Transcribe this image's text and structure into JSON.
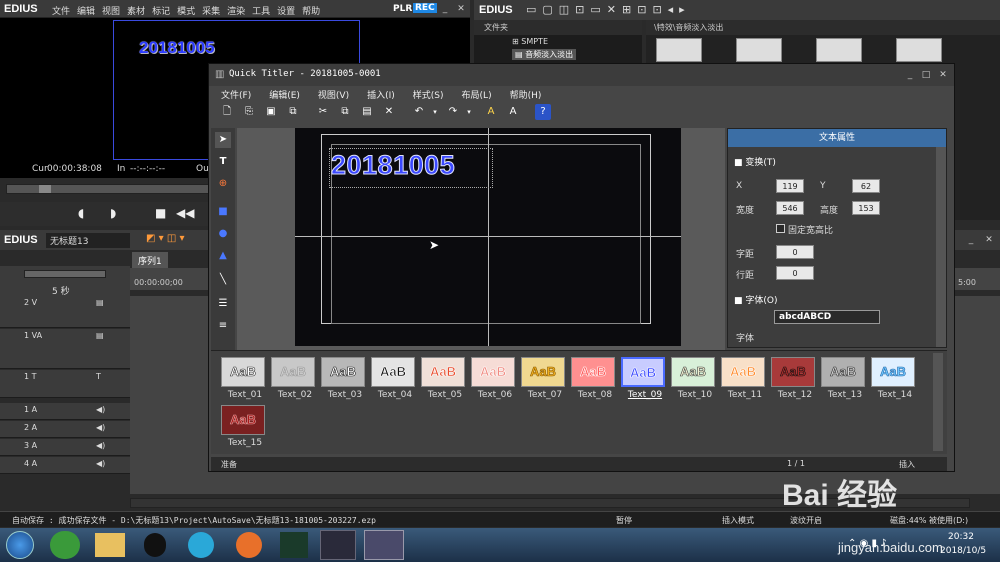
{
  "edius_main": {
    "logo": "EDIUS",
    "menu": [
      "文件",
      "编辑",
      "视图",
      "素材",
      "标记",
      "模式",
      "采集",
      "渲染",
      "工具",
      "设置",
      "帮助"
    ],
    "plr": "PLR",
    "rec": "REC",
    "preview_text": "20181005",
    "cur_label": "Cur",
    "cur_time": "00:00:38:08",
    "in_label": "In",
    "in_time": "--:--:--:--",
    "out_label": "Ou"
  },
  "edius_right": {
    "logo": "EDIUS",
    "folder_header": "文件夹",
    "tree_items": [
      "SMPTE",
      "音频淡入淡出"
    ],
    "path": "\\特效\\音频淡入淡出"
  },
  "timeline": {
    "logo": "EDIUS",
    "project": "无标题13",
    "sequence_tab": "序列1",
    "start_tc": "00:00:00;00",
    "end_tc": "5:00",
    "zoom": "5 秒",
    "tracks": [
      {
        "name": "2 V",
        "type": "video"
      },
      {
        "name": "1 VA",
        "type": "va"
      },
      {
        "name": "1 T",
        "type": "title"
      },
      {
        "name": "1 A",
        "type": "audio"
      },
      {
        "name": "2 A",
        "type": "audio"
      },
      {
        "name": "3 A",
        "type": "audio"
      },
      {
        "name": "4 A",
        "type": "audio"
      }
    ]
  },
  "quick_titler": {
    "title": "Quick Titler - 20181005-0001",
    "menu": [
      "文件(F)",
      "编辑(E)",
      "视图(V)",
      "插入(I)",
      "样式(S)",
      "布局(L)",
      "帮助(H)"
    ],
    "canvas_text": "20181005",
    "props": {
      "header": "文本属性",
      "transform_label": "变换(T)",
      "x_label": "X",
      "x_value": "119",
      "y_label": "Y",
      "y_value": "62",
      "width_label": "宽度",
      "width_value": "546",
      "height_label": "高度",
      "height_value": "153",
      "fixed_ratio_label": "固定宽高比",
      "char_spacing_label": "字距",
      "char_spacing_value": "0",
      "line_spacing_label": "行距",
      "line_spacing_value": "0",
      "font_section_label": "字体(O)",
      "font_preview": "abcdABCD",
      "font_label": "字体"
    },
    "styles": [
      {
        "name": "Text_01",
        "text": "AaB",
        "fg": "#ffffff",
        "bg": "#d8d8d8",
        "stroke": "#333333"
      },
      {
        "name": "Text_02",
        "text": "AaB",
        "fg": "#cfcfcf",
        "bg": "#c8c8c8",
        "stroke": "#999999"
      },
      {
        "name": "Text_03",
        "text": "AaB",
        "fg": "#ffffff",
        "bg": "#b8b8b8",
        "stroke": "#222222"
      },
      {
        "name": "Text_04",
        "text": "AaB",
        "fg": "#111111",
        "bg": "#e4e4e4",
        "stroke": "#ffffff"
      },
      {
        "name": "Text_05",
        "text": "AaB",
        "fg": "#e84a2a",
        "bg": "#f0e0d8",
        "stroke": "#ffffff"
      },
      {
        "name": "Text_06",
        "text": "AaB",
        "fg": "#f08a80",
        "bg": "#f6dcd6",
        "stroke": "#ffffff"
      },
      {
        "name": "Text_07",
        "text": "AaB",
        "fg": "#f0b020",
        "bg": "#f0d890",
        "stroke": "#8a5a00"
      },
      {
        "name": "Text_08",
        "text": "AaB",
        "fg": "#ff5a5a",
        "bg": "#ff9090",
        "stroke": "#ffffff"
      },
      {
        "name": "Text_09",
        "text": "AaB",
        "fg": "#3a48ff",
        "bg": "#c8ccff",
        "stroke": "#ffffff"
      },
      {
        "name": "Text_10",
        "text": "AaB",
        "fg": "#f0f0d0",
        "bg": "#d8f0d8",
        "stroke": "#444444"
      },
      {
        "name": "Text_11",
        "text": "AaB",
        "fg": "#ff8a2a",
        "bg": "#f8e0c8",
        "stroke": "#ffffff"
      },
      {
        "name": "Text_12",
        "text": "AaB",
        "fg": "#aa2a2a",
        "bg": "#a83a3a",
        "stroke": "#111111"
      },
      {
        "name": "Text_13",
        "text": "AaB",
        "fg": "#cfcfcf",
        "bg": "#b0b0b0",
        "stroke": "#333333"
      },
      {
        "name": "Text_14",
        "text": "AaB",
        "fg": "#70c8ff",
        "bg": "#e0f0ff",
        "stroke": "#2a6aaa"
      },
      {
        "name": "Text_15",
        "text": "AaB",
        "fg": "#aa1a1a",
        "bg": "#7a2020",
        "stroke": "#e0a0a0"
      }
    ],
    "selected_style": "Text_09",
    "status_left": "准备",
    "status_page": "1 / 1",
    "status_mode": "插入"
  },
  "statusbar": {
    "autosave": "自动保存 : 成功保存文件 - D:\\无标题13\\Project\\AutoSave\\无标题13-181005-203227.ezp",
    "paused": "暂停",
    "insert_mode": "插入模式",
    "ripple": "波纹开启",
    "disk": "磁盘:44% 被使用(D:)"
  },
  "taskbar": {
    "time": "20:32",
    "date": "2018/10/5"
  },
  "watermark": {
    "text": "Bai 经验",
    "url": "jingyan.baidu.com"
  },
  "colors": {
    "accent_blue": "#3344dd",
    "props_header": "#3b6ea5",
    "titlebar": "#3c3c3c"
  }
}
